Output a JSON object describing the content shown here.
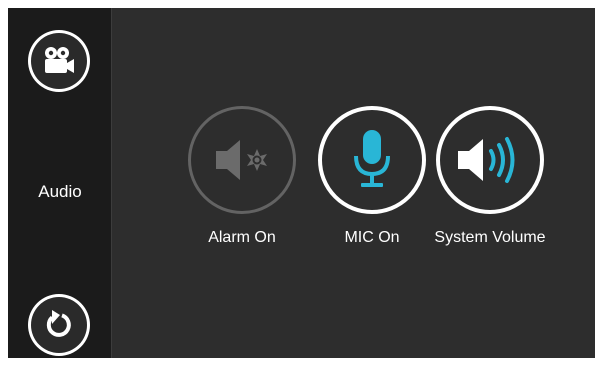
{
  "sidebar": {
    "section_label": "Audio",
    "top_icon": "video-camera-icon",
    "bottom_icon": "refresh-back-icon"
  },
  "controls": [
    {
      "label": "Alarm On",
      "icon": "speaker-alarm-icon",
      "state": "inactive"
    },
    {
      "label": "MIC On",
      "icon": "microphone-icon",
      "state": "active"
    },
    {
      "label": "System Volume",
      "icon": "speaker-volume-icon",
      "state": "active"
    }
  ],
  "colors": {
    "accent": "#29b6d6",
    "background": "#2d2d2d",
    "sidebar": "#1b1b1b",
    "inactive": "#636363",
    "text": "#ffffff"
  }
}
